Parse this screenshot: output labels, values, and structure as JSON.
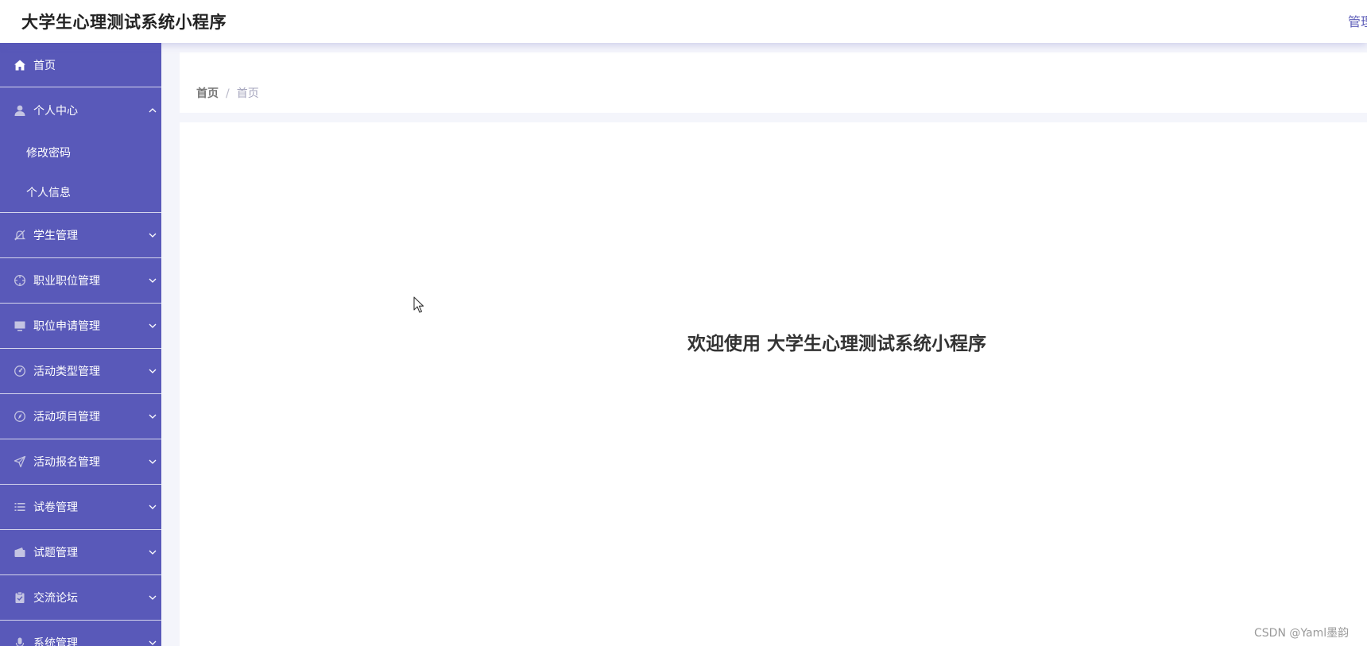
{
  "header": {
    "app_title": "大学生心理测试系统小程序",
    "user_label": "管理"
  },
  "sidebar": {
    "home_label": "首页",
    "personal": {
      "label": "个人中心",
      "children": [
        "修改密码",
        "个人信息"
      ]
    },
    "items": [
      {
        "label": "学生管理",
        "icon": "bell-off-icon"
      },
      {
        "label": "职业职位管理",
        "icon": "aim-icon"
      },
      {
        "label": "职位申请管理",
        "icon": "monitor-icon"
      },
      {
        "label": "活动类型管理",
        "icon": "gauge-icon"
      },
      {
        "label": "活动项目管理",
        "icon": "compass-icon"
      },
      {
        "label": "活动报名管理",
        "icon": "send-icon"
      },
      {
        "label": "试卷管理",
        "icon": "list-icon"
      },
      {
        "label": "试题管理",
        "icon": "wallet-icon"
      },
      {
        "label": "交流论坛",
        "icon": "clipboard-icon"
      },
      {
        "label": "系统管理",
        "icon": "microphone-icon"
      }
    ]
  },
  "breadcrumb": {
    "root": "首页",
    "separator": "/",
    "current": "首页"
  },
  "main": {
    "welcome_text": "欢迎使用 大学生心理测试系统小程序"
  },
  "watermark": "CSDN @Yaml墨韵",
  "colors": {
    "sidebar_bg": "#5959b9",
    "accent": "#5b5bb8",
    "page_bg": "#f4f5fb"
  }
}
